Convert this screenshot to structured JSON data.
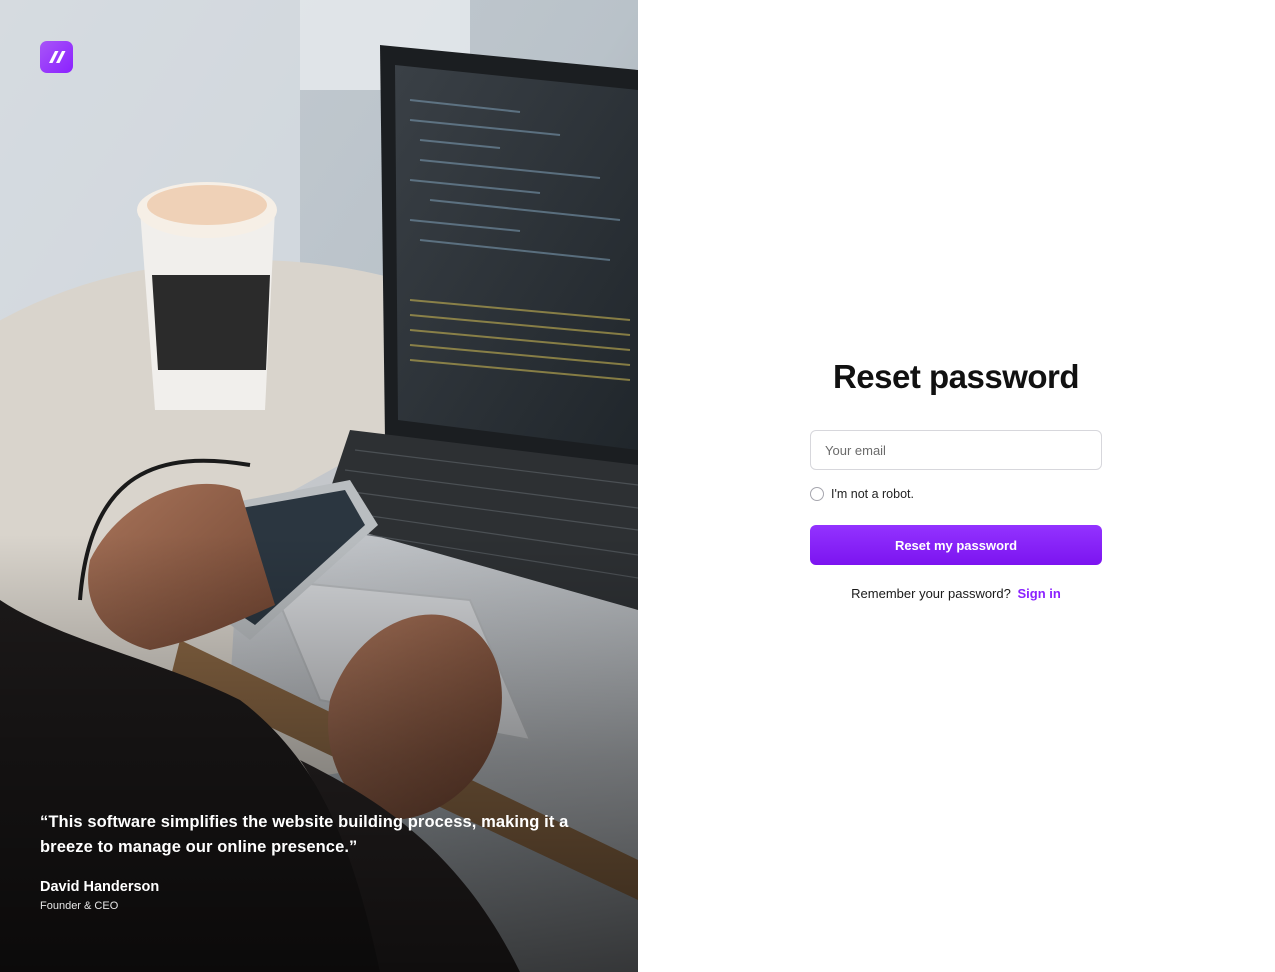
{
  "hero": {
    "photo_icon": "laptop-coffee-photo",
    "logo_icon": "brand-logo-icon",
    "quote": "“This software simplifies the website building process, making it a breeze to manage our online presence.”",
    "author": "David Handerson",
    "role": "Founder & CEO"
  },
  "form": {
    "title": "Reset password",
    "email_placeholder": "Your email",
    "email_value": "",
    "robot_label": "I'm not a robot.",
    "submit_label": "Reset my password",
    "remember_text": "Remember your password?",
    "signin_label": "Sign in"
  },
  "colors": {
    "accent": "#8b21ff",
    "title": "#111111",
    "border": "#d7d7dc"
  }
}
